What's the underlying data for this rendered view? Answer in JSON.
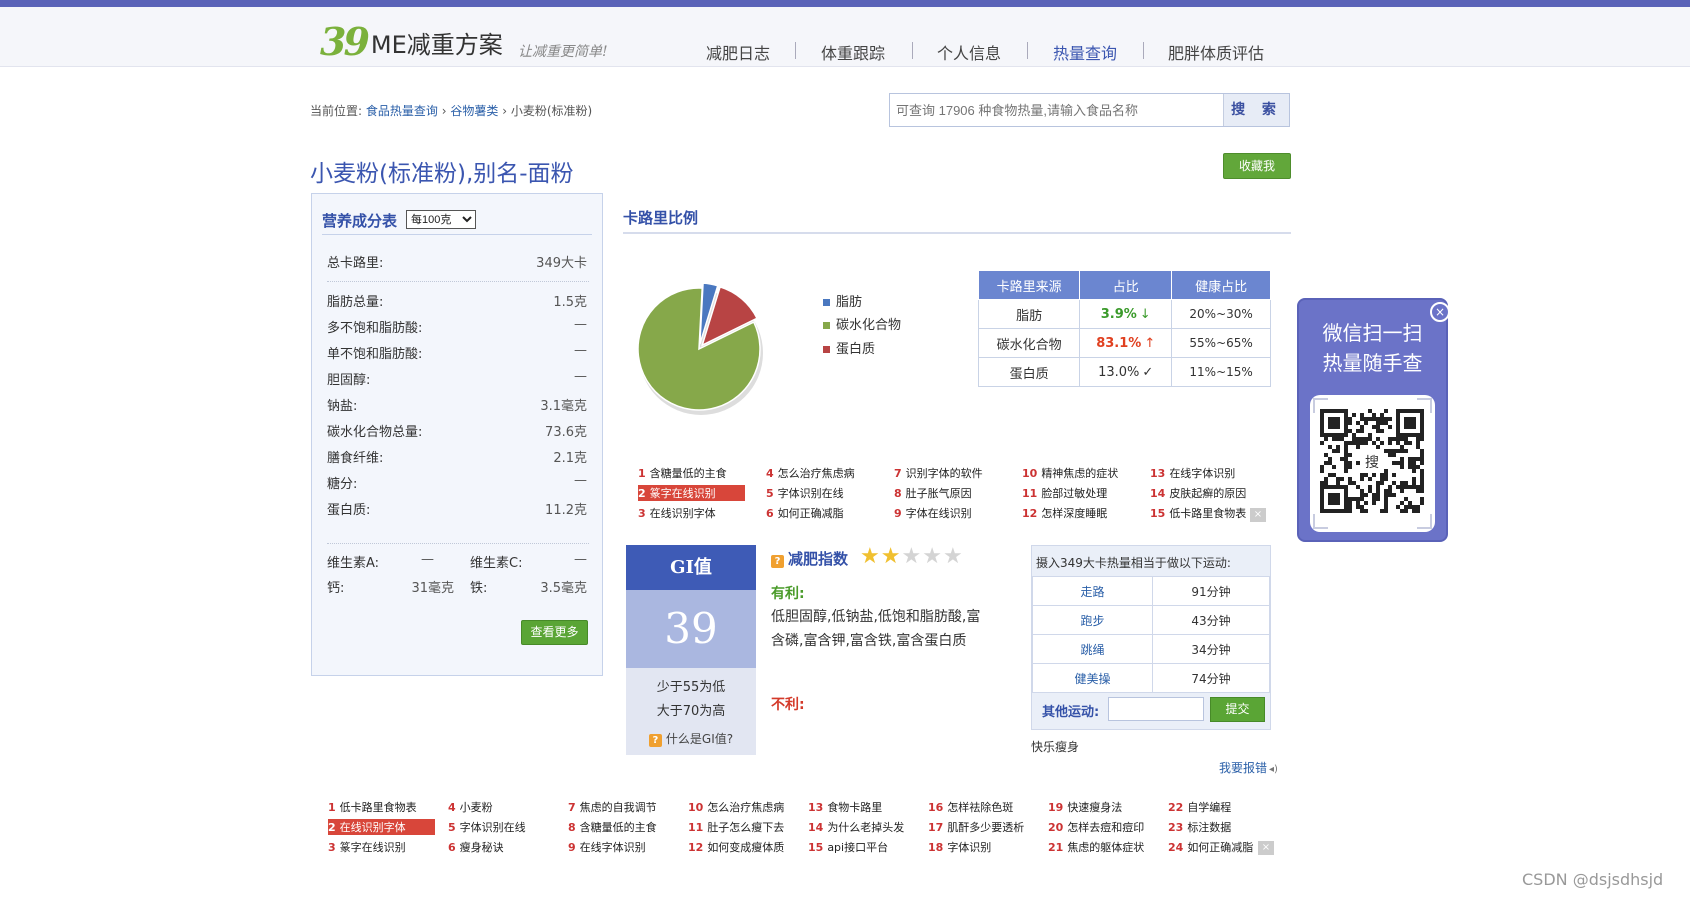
{
  "site": {
    "logo_mark": "39",
    "logo_name": "ME减重方案",
    "slogan": "让减重更简单!",
    "nav": [
      "减肥日志",
      "体重跟踪",
      "个人信息",
      "热量查询",
      "肥胖体质评估"
    ],
    "active_nav": "热量查询"
  },
  "breadcrumb": {
    "prefix": "当前位置:",
    "items": [
      "食品热量查询",
      "谷物薯类"
    ],
    "sep": "›",
    "current": "小麦粉(标准粉)"
  },
  "search": {
    "placeholder": "可查询 17906 种食物热量,请输入食品名称",
    "button": "搜 索"
  },
  "food": {
    "title": "小麦粉(标准粉),别名-面粉",
    "favorite_button": "收藏我"
  },
  "nutrition": {
    "heading": "营养成分表",
    "unit_select": "每100克",
    "calories_label": "总卡路里:",
    "calories_value": "349大卡",
    "rows": [
      {
        "label": "脂肪总量:",
        "value": "1.5克"
      },
      {
        "label": "多不饱和脂肪酸:",
        "value": "—"
      },
      {
        "label": "单不饱和脂肪酸:",
        "value": "—"
      },
      {
        "label": "胆固醇:",
        "value": "—"
      },
      {
        "label": "钠盐:",
        "value": "3.1毫克"
      },
      {
        "label": "碳水化合物总量:",
        "value": "73.6克"
      },
      {
        "label": "膳食纤维:",
        "value": "2.1克"
      },
      {
        "label": "糖分:",
        "value": "—"
      },
      {
        "label": "蛋白质:",
        "value": "11.2克"
      }
    ],
    "vitamins": [
      {
        "label": "维生素A:",
        "value": "—"
      },
      {
        "label": "维生素C:",
        "value": "—"
      },
      {
        "label": "钙:",
        "value": "31毫克"
      },
      {
        "label": "铁:",
        "value": "3.5毫克"
      }
    ],
    "more_button": "查看更多"
  },
  "calorie_ratio": {
    "heading": "卡路里比例",
    "legend": [
      {
        "name": "脂肪",
        "color": "#4a78c0",
        "percent": 3.9
      },
      {
        "name": "碳水化合物",
        "color": "#86a84a",
        "percent": 83.1
      },
      {
        "name": "蛋白质",
        "color": "#b84444",
        "percent": 13.0
      }
    ],
    "table_headers": [
      "卡路里来源",
      "占比",
      "健康占比"
    ],
    "table_rows": [
      {
        "source": "脂肪",
        "ratio": "3.9%",
        "trend": "↓",
        "healthy": "20%~30%",
        "color": "#3a9a2a"
      },
      {
        "source": "碳水化合物",
        "ratio": "83.1%",
        "trend": "↑",
        "healthy": "55%~65%",
        "color": "#e04020"
      },
      {
        "source": "蛋白质",
        "ratio": "13.0%",
        "trend": "✓",
        "healthy": "11%~15%",
        "color": "#333333"
      }
    ]
  },
  "ads_top": [
    {
      "n": "1",
      "t": "含糖量低的主食"
    },
    {
      "n": "2",
      "t": "篆字在线识别"
    },
    {
      "n": "3",
      "t": "在线识别字体"
    },
    {
      "n": "4",
      "t": "怎么治疗焦虑病"
    },
    {
      "n": "5",
      "t": "字体识别在线"
    },
    {
      "n": "6",
      "t": "如何正确减脂"
    },
    {
      "n": "7",
      "t": "识别字体的软件"
    },
    {
      "n": "8",
      "t": "肚子胀气原因"
    },
    {
      "n": "9",
      "t": "字体在线识别"
    },
    {
      "n": "10",
      "t": "精神焦虑的症状"
    },
    {
      "n": "11",
      "t": "脸部过敏处理"
    },
    {
      "n": "12",
      "t": "怎样深度睡眠"
    },
    {
      "n": "13",
      "t": "在线字体识别"
    },
    {
      "n": "14",
      "t": "皮肤起癣的原因"
    },
    {
      "n": "15",
      "t": "低卡路里食物表"
    }
  ],
  "gi": {
    "heading": "GI值",
    "value": "39",
    "desc1": "少于55为低",
    "desc2": "大于70为高",
    "help": "什么是GI值?"
  },
  "diet": {
    "heading": "减肥指数",
    "stars": 2,
    "stars_max": 5,
    "pros_label": "有利:",
    "pros_text": "低胆固醇,低钠盐,低饱和脂肪酸,富含磷,富含钾,富含铁,富含蛋白质",
    "cons_label": "不利:"
  },
  "exercise": {
    "caption": "摄入349大卡热量相当于做以下运动:",
    "rows": [
      {
        "activity": "走路",
        "time": "91分钟"
      },
      {
        "activity": "跑步",
        "time": "43分钟"
      },
      {
        "activity": "跳绳",
        "time": "34分钟"
      },
      {
        "activity": "健美操",
        "time": "74分钟"
      }
    ],
    "other_label": "其他运动:",
    "submit": "提交",
    "tagline": "快乐瘦身",
    "report": "我要报错"
  },
  "ads_bottom": [
    {
      "n": "1",
      "t": "低卡路里食物表"
    },
    {
      "n": "2",
      "t": "在线识别字体"
    },
    {
      "n": "3",
      "t": "篆字在线识别"
    },
    {
      "n": "4",
      "t": "小麦粉"
    },
    {
      "n": "5",
      "t": "字体识别在线"
    },
    {
      "n": "6",
      "t": "瘦身秘诀"
    },
    {
      "n": "7",
      "t": "焦虑的自我调节"
    },
    {
      "n": "8",
      "t": "含糖量低的主食"
    },
    {
      "n": "9",
      "t": "在线字体识别"
    },
    {
      "n": "10",
      "t": "怎么治疗焦虑病"
    },
    {
      "n": "11",
      "t": "肚子怎么瘦下去"
    },
    {
      "n": "12",
      "t": "如何变成瘦体质"
    },
    {
      "n": "13",
      "t": "食物卡路里"
    },
    {
      "n": "14",
      "t": "为什么老掉头发"
    },
    {
      "n": "15",
      "t": "api接口平台"
    },
    {
      "n": "16",
      "t": "怎样祛除色斑"
    },
    {
      "n": "17",
      "t": "肌酐多少要透析"
    },
    {
      "n": "18",
      "t": "字体识别"
    },
    {
      "n": "19",
      "t": "快速瘦身法"
    },
    {
      "n": "20",
      "t": "怎样去痘和痘印"
    },
    {
      "n": "21",
      "t": "焦虑的躯体症状"
    },
    {
      "n": "22",
      "t": "自学编程"
    },
    {
      "n": "23",
      "t": "标注数据"
    },
    {
      "n": "24",
      "t": "如何正确减脂"
    }
  ],
  "qr_panel": {
    "line1": "微信扫一扫",
    "line2": "热量随手查",
    "close": "×",
    "center_glyph": "搜"
  },
  "watermark": "CSDN @dsjsdhsjd"
}
